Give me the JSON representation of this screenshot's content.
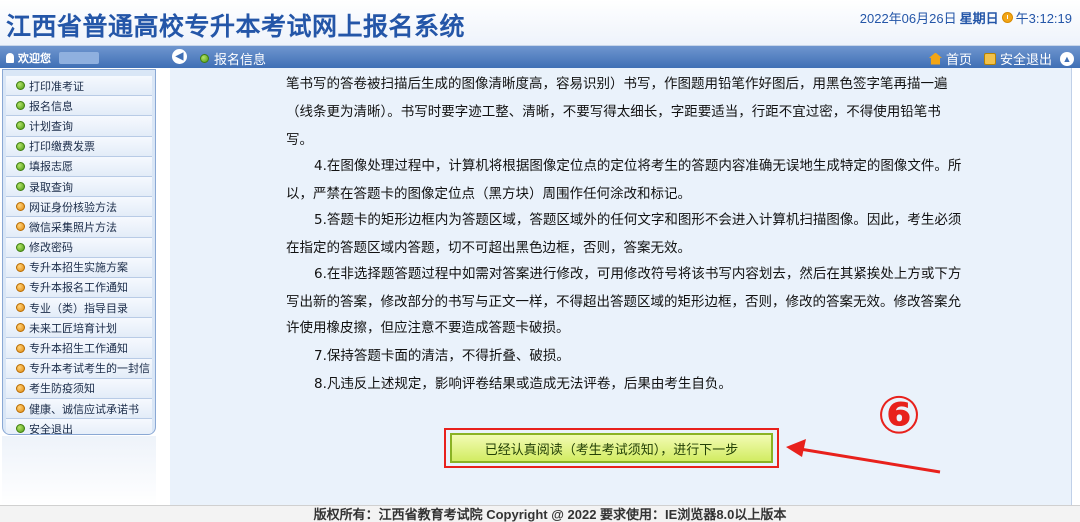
{
  "header": {
    "site_title": "江西省普通高校专升本考试网上报名系统",
    "date": "2022年06月26日",
    "weekday": "星期日",
    "time": "午3:12:19"
  },
  "navbar": {
    "welcome": "欢迎您",
    "breadcrumb": "报名信息",
    "home_label": "首页",
    "logout_label": "安全退出"
  },
  "sidebar": {
    "items": [
      {
        "label": "打印准考证",
        "icon": "green-dot"
      },
      {
        "label": "报名信息",
        "icon": "green-dot"
      },
      {
        "label": "计划查询",
        "icon": "green-dot"
      },
      {
        "label": "打印缴费发票",
        "icon": "green-dot"
      },
      {
        "label": "填报志愿",
        "icon": "green-dot"
      },
      {
        "label": "录取查询",
        "icon": "green-dot"
      },
      {
        "label": "网证身份核验方法",
        "icon": "orange-dot"
      },
      {
        "label": "微信采集照片方法",
        "icon": "orange-dot"
      },
      {
        "label": "修改密码",
        "icon": "green-dot"
      },
      {
        "label": "专升本招生实施方案",
        "icon": "orange-dot"
      },
      {
        "label": "专升本报名工作通知",
        "icon": "orange-dot"
      },
      {
        "label": "专业（类）指导目录",
        "icon": "orange-dot"
      },
      {
        "label": "未来工匠培育计划",
        "icon": "orange-dot"
      },
      {
        "label": "专升本招生工作通知",
        "icon": "orange-dot"
      },
      {
        "label": "专升本考试考生的一封信",
        "icon": "orange-dot"
      },
      {
        "label": "考生防疫须知",
        "icon": "orange-dot"
      },
      {
        "label": "健康、诚信应试承诺书",
        "icon": "orange-dot"
      },
      {
        "label": "安全退出",
        "icon": "green-dot"
      }
    ]
  },
  "main": {
    "lines": [
      {
        "text": "笔书写的答卷被扫描后生成的图像清晰度高，容易识别）书写，作图题用铅笔作好图后，用黑色签字笔再描一遍",
        "indent": false
      },
      {
        "text": "（线条更为清晰）。书写时要字迹工整、清晰，不要写得太细长，字距要适当，行距不宜过密，不得使用铅笔书",
        "indent": false
      },
      {
        "text": "写。",
        "indent": false
      },
      {
        "text": "4.在图像处理过程中，计算机将根据图像定位点的定位将考生的答题内容准确无误地生成特定的图像文件。所",
        "indent": true
      },
      {
        "text": "以，严禁在答题卡的图像定位点（黑方块）周围作任何涂改和标记。",
        "indent": false
      },
      {
        "text": "5.答题卡的矩形边框内为答题区域，答题区域外的任何文字和图形不会进入计算机扫描图像。因此，考生必须",
        "indent": true
      },
      {
        "text": "在指定的答题区域内答题，切不可超出黑色边框，否则，答案无效。",
        "indent": false
      },
      {
        "text": "6.在非选择题答题过程中如需对答案进行修改，可用修改符号将该书写内容划去，然后在其紧挨处上方或下方",
        "indent": true
      },
      {
        "text": "写出新的答案，修改部分的书写与正文一样，不得超出答题区域的矩形边框，否则，修改的答案无效。修改答案允",
        "indent": false
      },
      {
        "text": "许使用橡皮擦，但应注意不要造成答题卡破损。",
        "indent": false
      },
      {
        "text": "7.保持答题卡面的清洁，不得折叠、破损。",
        "indent": true
      },
      {
        "text": "8.凡违反上述规定，影响评卷结果或造成无法评卷，后果由考生自负。",
        "indent": true
      }
    ],
    "confirm_button": "已经认真阅读（考生考试须知），进行下一步",
    "annotation_number": "⑥"
  },
  "footer": {
    "text": "版权所有：江西省教育考试院 Copyright @ 2022 要求使用：IE浏览器8.0以上版本"
  },
  "colors": {
    "title_blue": "#2456a8",
    "nav_blue": "#4a78bc",
    "button_green": "#d2ec62",
    "annotation_red": "#e8211c"
  }
}
